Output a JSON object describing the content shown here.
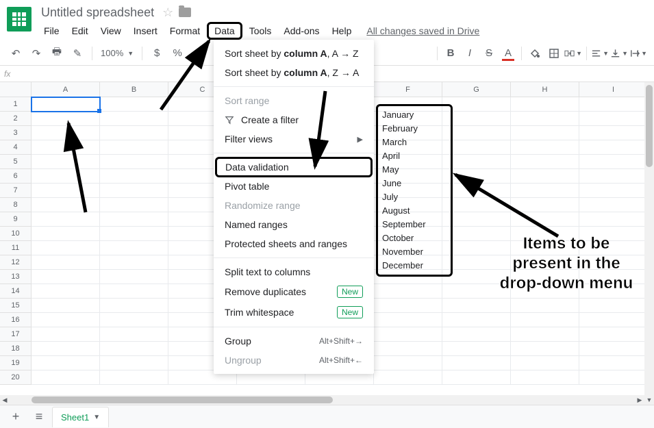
{
  "header": {
    "title": "Untitled spreadsheet",
    "save_status": "All changes saved in Drive"
  },
  "menubar": {
    "items": [
      "File",
      "Edit",
      "View",
      "Insert",
      "Format",
      "Data",
      "Tools",
      "Add-ons",
      "Help"
    ]
  },
  "toolbar": {
    "zoom": "100%",
    "currency": "$",
    "percent": "%"
  },
  "formula_bar": {
    "fx": "fx"
  },
  "columns": [
    "A",
    "B",
    "C",
    "D",
    "E",
    "F",
    "G",
    "H",
    "I"
  ],
  "row_count": 20,
  "selected_cell": {
    "row": 1,
    "col": "A"
  },
  "data_menu": {
    "sort_az_prefix": "Sort sheet by ",
    "sort_az_bold": "column A",
    "sort_az_suffix": ", A → Z",
    "sort_za_prefix": "Sort sheet by ",
    "sort_za_bold": "column A",
    "sort_za_suffix": ", Z → A",
    "sort_range": "Sort range",
    "create_filter": "Create a filter",
    "filter_views": "Filter views",
    "data_validation": "Data validation",
    "pivot_table": "Pivot table",
    "randomize_range": "Randomize range",
    "named_ranges": "Named ranges",
    "protected_sheets": "Protected sheets and ranges",
    "split_text": "Split text to columns",
    "remove_duplicates": "Remove duplicates",
    "trim_whitespace": "Trim whitespace",
    "group": "Group",
    "ungroup": "Ungroup",
    "new_badge": "New",
    "shortcut_group": "Alt+Shift+→",
    "shortcut_ungroup": "Alt+Shift+←"
  },
  "months": [
    "January",
    "February",
    "March",
    "April",
    "May",
    "June",
    "July",
    "August",
    "September",
    "October",
    "November",
    "December"
  ],
  "annotation": "Items to be present in the drop-down menu",
  "sheet_tab": {
    "name": "Sheet1"
  }
}
